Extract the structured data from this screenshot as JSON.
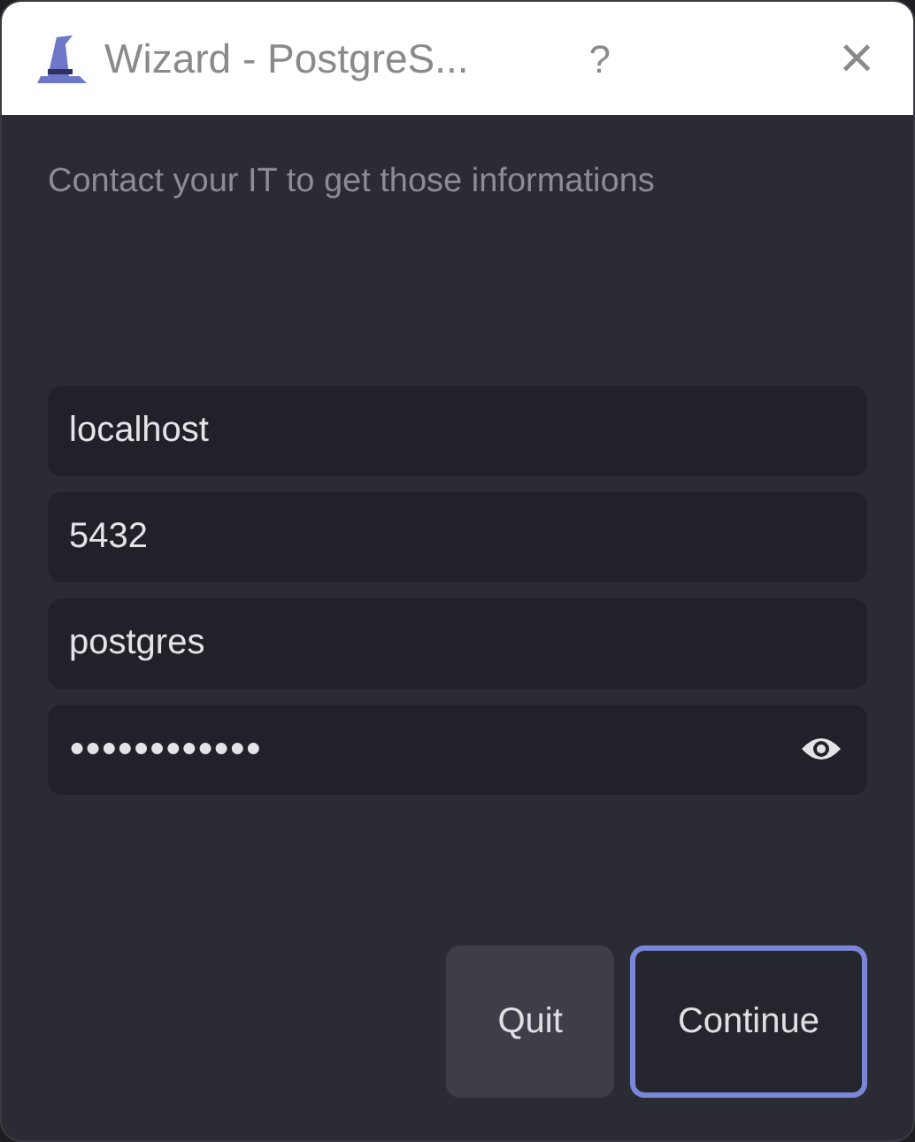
{
  "window": {
    "title": "Wizard - PostgreS...",
    "help": "?",
    "close": "×"
  },
  "hint": "Contact your IT to get those informations",
  "fields": [
    {
      "kind": "text",
      "value": "localhost"
    },
    {
      "kind": "text",
      "value": "5432"
    },
    {
      "kind": "text",
      "value": "postgres"
    },
    {
      "kind": "password",
      "value": "●●●●●●●●●●●●"
    }
  ],
  "buttons": [
    {
      "label": "Quit",
      "focused": false
    },
    {
      "label": "Continue",
      "focused": true
    }
  ]
}
